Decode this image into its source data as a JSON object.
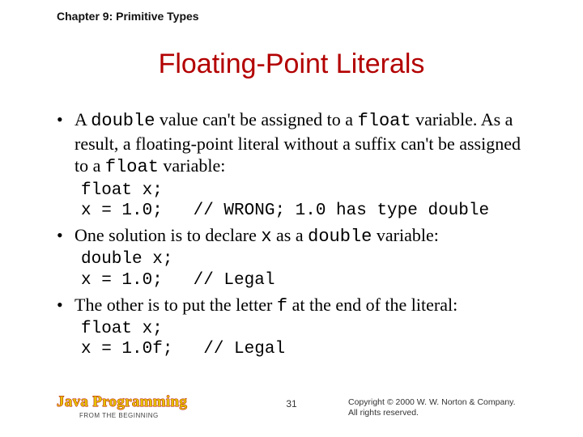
{
  "chapter": "Chapter 9: Primitive Types",
  "title": "Floating-Point Literals",
  "bullets": {
    "b1": {
      "t1": "A ",
      "c1": "double",
      "t2": " value can't be assigned to a ",
      "c2": "float",
      "t3": " variable. As a result, a floating-point literal without a suffix can't be assigned to a ",
      "c3": "float",
      "t4": " variable:"
    },
    "code1": "float x;\nx = 1.0;   // WRONG; 1.0 has type double",
    "b2": {
      "t1": "One solution is to declare ",
      "c1": "x",
      "t2": " as a ",
      "c2": "double",
      "t3": " variable:"
    },
    "code2": "double x;\nx = 1.0;   // Legal",
    "b3": {
      "t1": "The other is to put the letter ",
      "c1": "f",
      "t2": " at the end of the literal:"
    },
    "code3": "float x;\nx = 1.0f;   // Legal"
  },
  "footer": {
    "brand": "Java Programming",
    "subbrand": "FROM THE BEGINNING",
    "page": "31",
    "copy1": "Copyright © 2000 W. W. Norton & Company.",
    "copy2": "All rights reserved."
  }
}
